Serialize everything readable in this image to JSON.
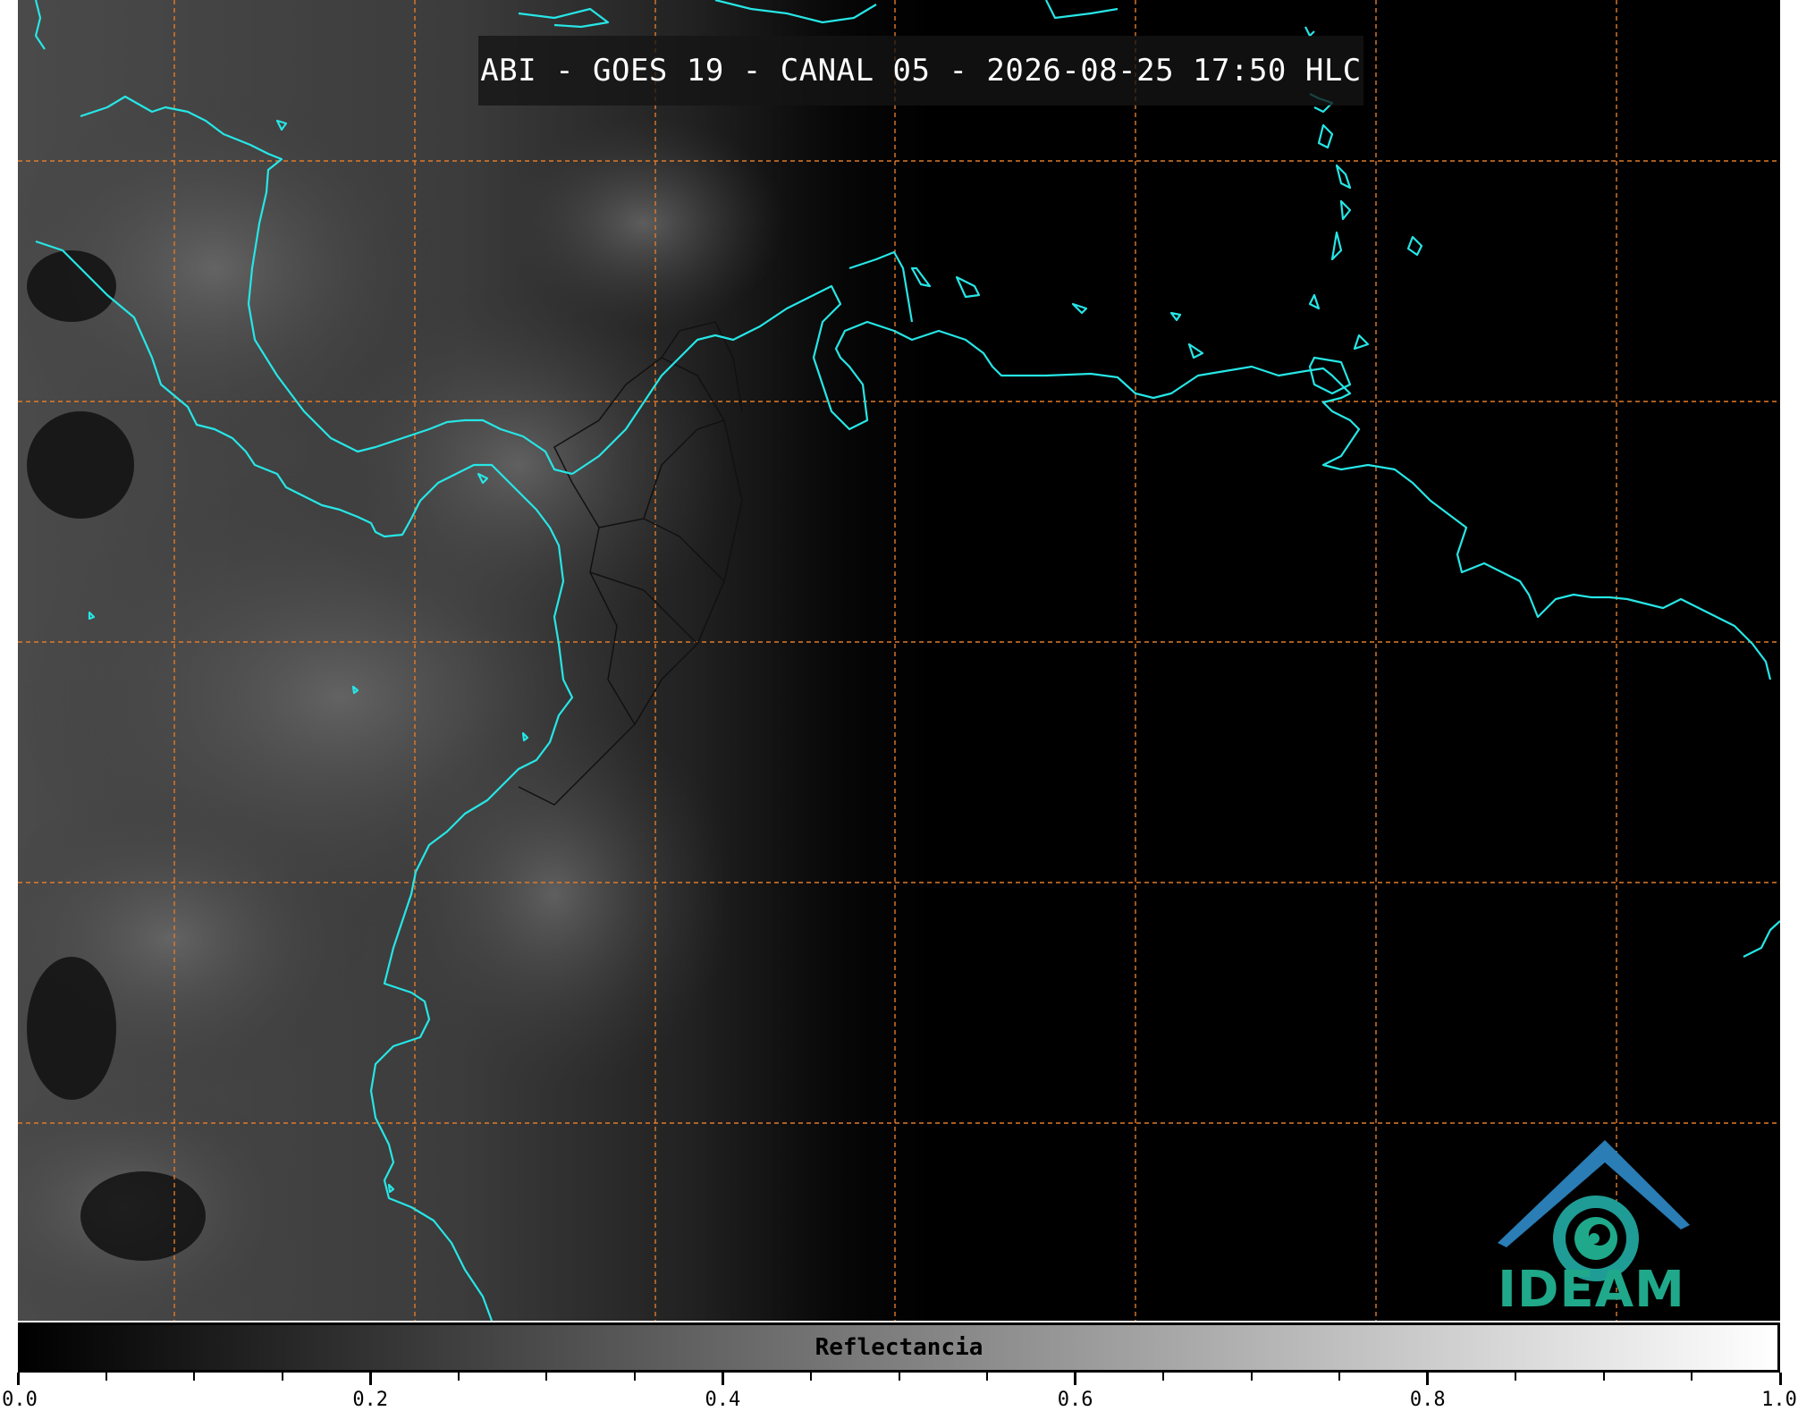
{
  "title": "ABI - GOES 19 - CANAL 05 - 2026-08-25 17:50 HLC",
  "colorbar": {
    "label": "Reflectancia",
    "ticks": [
      "0.0",
      "0.2",
      "0.4",
      "0.6",
      "0.8",
      "1.0"
    ],
    "range": [
      0.0,
      1.0
    ],
    "colormap": "gray"
  },
  "logo": {
    "text": "IDEAM",
    "color": "#1fa98a",
    "accent": "#2a7db5"
  },
  "colors": {
    "coastline": "#27e6e6",
    "gridline": "#e07a2a",
    "borders": "#111111",
    "background": "#000000"
  },
  "icons": [
    "ideam-logo-icon"
  ]
}
